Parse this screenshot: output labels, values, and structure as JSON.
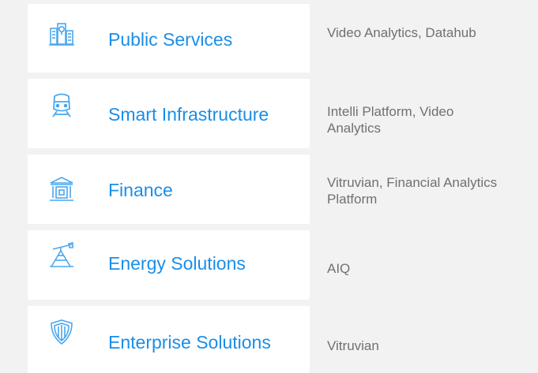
{
  "sectors": [
    {
      "icon": "city-map-icon",
      "label": "Public Services",
      "products": "Video Analytics, Datahub"
    },
    {
      "icon": "train-icon",
      "label": "Smart Infrastructure",
      "products": "Intelli Platform, Video Analytics"
    },
    {
      "icon": "bank-icon",
      "label": "Finance",
      "products": "Vitruvian, Financial Analytics Platform"
    },
    {
      "icon": "oil-pump-icon",
      "label": "Energy Solutions",
      "products": "AIQ"
    },
    {
      "icon": "shield-icon",
      "label": "Enterprise Solutions",
      "products": "Vitruvian"
    }
  ],
  "colors": {
    "accent": "#1a8ee8",
    "icon": "#4aa7ef",
    "text_muted": "#707070",
    "row_bg": "#ffffff",
    "page_bg": "#f2f2f3"
  }
}
